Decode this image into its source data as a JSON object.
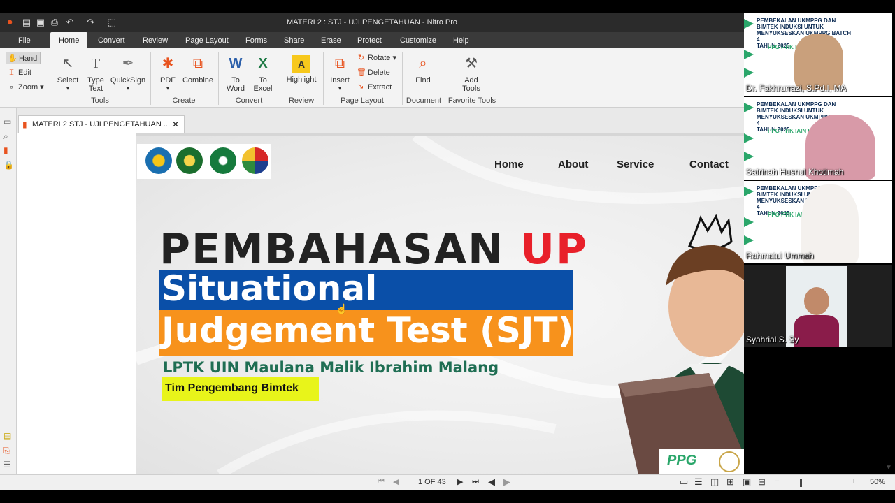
{
  "window": {
    "title": "MATERI 2 : STJ - UJI PENGETAHUAN  - Nitro Pro"
  },
  "menu": {
    "file": "File",
    "home": "Home",
    "convert": "Convert",
    "review": "Review",
    "page_layout": "Page Layout",
    "forms": "Forms",
    "share": "Share",
    "erase": "Erase",
    "protect": "Protect",
    "customize": "Customize",
    "help": "Help"
  },
  "ribbon": {
    "hand": "Hand",
    "edit": "Edit",
    "zoom": "Zoom",
    "select": "Select",
    "type_text_1": "Type",
    "type_text_2": "Text",
    "quicksign": "QuickSign",
    "tools_group": "Tools",
    "pdf": "PDF",
    "combine": "Combine",
    "create_group": "Create",
    "to_word_1": "To",
    "to_word_2": "Word",
    "to_excel_1": "To",
    "to_excel_2": "Excel",
    "convert_group": "Convert",
    "highlight": "Highlight",
    "review_group": "Review",
    "insert": "Insert",
    "rotate": "Rotate",
    "delete": "Delete",
    "extract": "Extract",
    "page_layout_group": "Page Layout",
    "find": "Find",
    "document_group": "Document",
    "add_tools_1": "Add",
    "add_tools_2": "Tools",
    "favorite_group": "Favorite Tools"
  },
  "tab": {
    "label": "MATERI 2  STJ - UJI PENGETAHUAN  ...",
    "close": "✕"
  },
  "slide": {
    "nav": [
      "Home",
      "About",
      "Service",
      "Contact"
    ],
    "headline_dark": "PEMBAHASAN",
    "headline_red": "UP",
    "band1": "Situational",
    "band2": "Judgement Test (SJT)",
    "subtitle": "LPTK UIN Maulana Malik Ibrahim Malang",
    "tag": "Tim Pengembang Bimtek",
    "badge": "PPG",
    "colors": {
      "blue": "#0a4fa8",
      "orange": "#f7921c",
      "red": "#e8202a",
      "green": "#1f6e53",
      "yellow": "#e8f41a"
    }
  },
  "status": {
    "page": "1 OF 43",
    "zoom": "50%"
  },
  "participants": [
    {
      "name": "Dr. Fakhrurrazi, S.Pd.I, MA"
    },
    {
      "name": "Safrinah Husnul Khotimah"
    },
    {
      "name": "Rahmatul Ummah"
    },
    {
      "name": "Syahrial S. Sy"
    }
  ],
  "banner": {
    "line1": "PEMBEKALAN UKMPPG DAN",
    "line2": "BIMTEK INDUKSI UNTUK",
    "line3": "MENYUKSESKAN UKMPPG BATCH 4",
    "line4": "TAHUN 2025",
    "org": "PPG FTIK IAIN LANGSA"
  }
}
